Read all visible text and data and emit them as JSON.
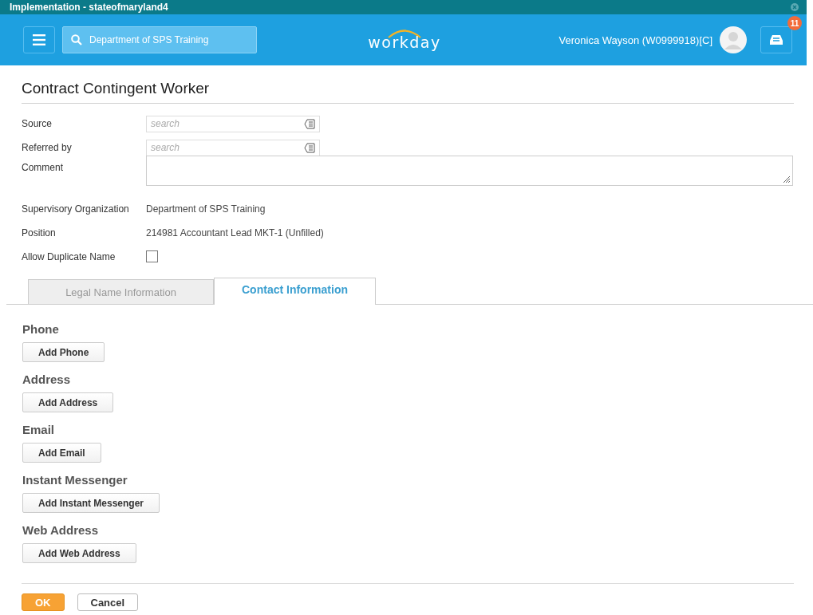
{
  "window": {
    "title": "Implementation - stateofmaryland4"
  },
  "header": {
    "search_value": "Department of SPS Training",
    "logo": "workday",
    "user": "Veronica Wayson (W0999918)[C]",
    "inbox_badge": "11"
  },
  "page_title": "Contract Contingent Worker",
  "fields": [
    {
      "kind": "search",
      "label": "Source",
      "placeholder": "search"
    },
    {
      "kind": "search",
      "label": "Referred by",
      "placeholder": "search"
    },
    {
      "kind": "textarea",
      "label": "Comment"
    },
    {
      "kind": "text",
      "label": "Supervisory Organization",
      "value": "Department of SPS Training"
    },
    {
      "kind": "text",
      "label": "Position",
      "value": "214981 Accountant Lead MKT-1 (Unfilled)"
    },
    {
      "kind": "checkbox",
      "label": "Allow Duplicate Name",
      "checked": false
    }
  ],
  "tabs": [
    {
      "label": "Legal Name Information",
      "selected": false
    },
    {
      "label": "Contact Information",
      "selected": true
    }
  ],
  "sections": [
    {
      "heading": "Phone",
      "button": "Add Phone"
    },
    {
      "heading": "Address",
      "button": "Add Address"
    },
    {
      "heading": "Email",
      "button": "Add Email"
    },
    {
      "heading": "Instant Messenger",
      "button": "Add Instant Messenger"
    },
    {
      "heading": "Web Address",
      "button": "Add Web Address"
    }
  ],
  "footer_buttons": [
    {
      "label": "OK",
      "primary": true
    },
    {
      "label": "Cancel",
      "primary": false
    }
  ]
}
